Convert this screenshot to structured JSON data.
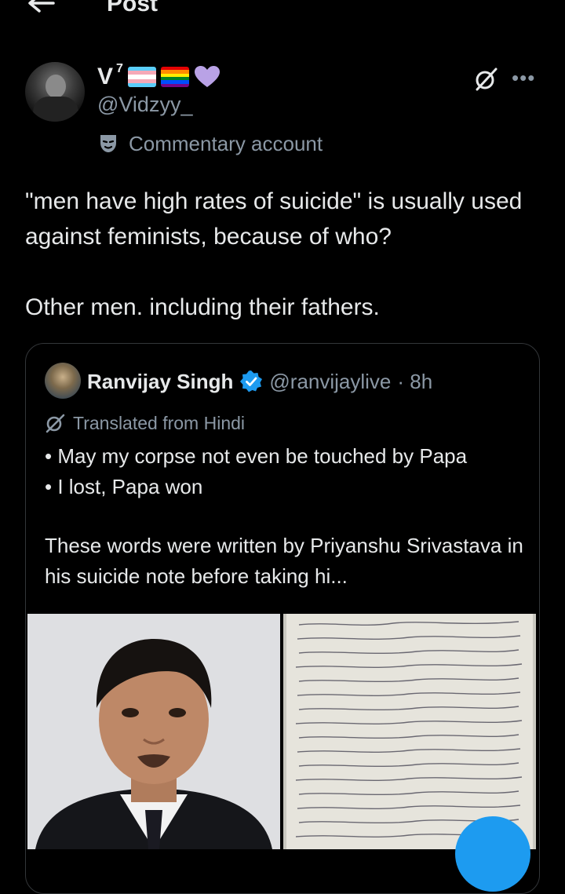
{
  "header": {
    "title": "Post",
    "back_icon": "arrow-left-icon"
  },
  "author": {
    "display_name": "V",
    "superscript": "7",
    "handle": "@Vidzyy_",
    "badges": [
      "transgender-flag",
      "rainbow-flag",
      "purple-heart"
    ],
    "label": "Commentary account",
    "label_icon": "mask-icon"
  },
  "tweet": {
    "line1": "\"men have high rates of suicide\" is usually used against feminists, because of who?",
    "line2": "Other men. including their fathers."
  },
  "quote": {
    "name": "Ranvijay Singh",
    "handle": "@ranvijaylive",
    "time": "· 8h",
    "translated": "Translated from Hindi",
    "bullet1": "• May my corpse not even be touched by Papa",
    "bullet2": "• I lost, Papa won",
    "body": "These words were written by Priyanshu Srivastava in his suicide note before taking hi..."
  },
  "colors": {
    "accent": "#1d9bf0",
    "muted": "#8b98a5",
    "text": "#e7e9ea",
    "bg": "#000000"
  }
}
